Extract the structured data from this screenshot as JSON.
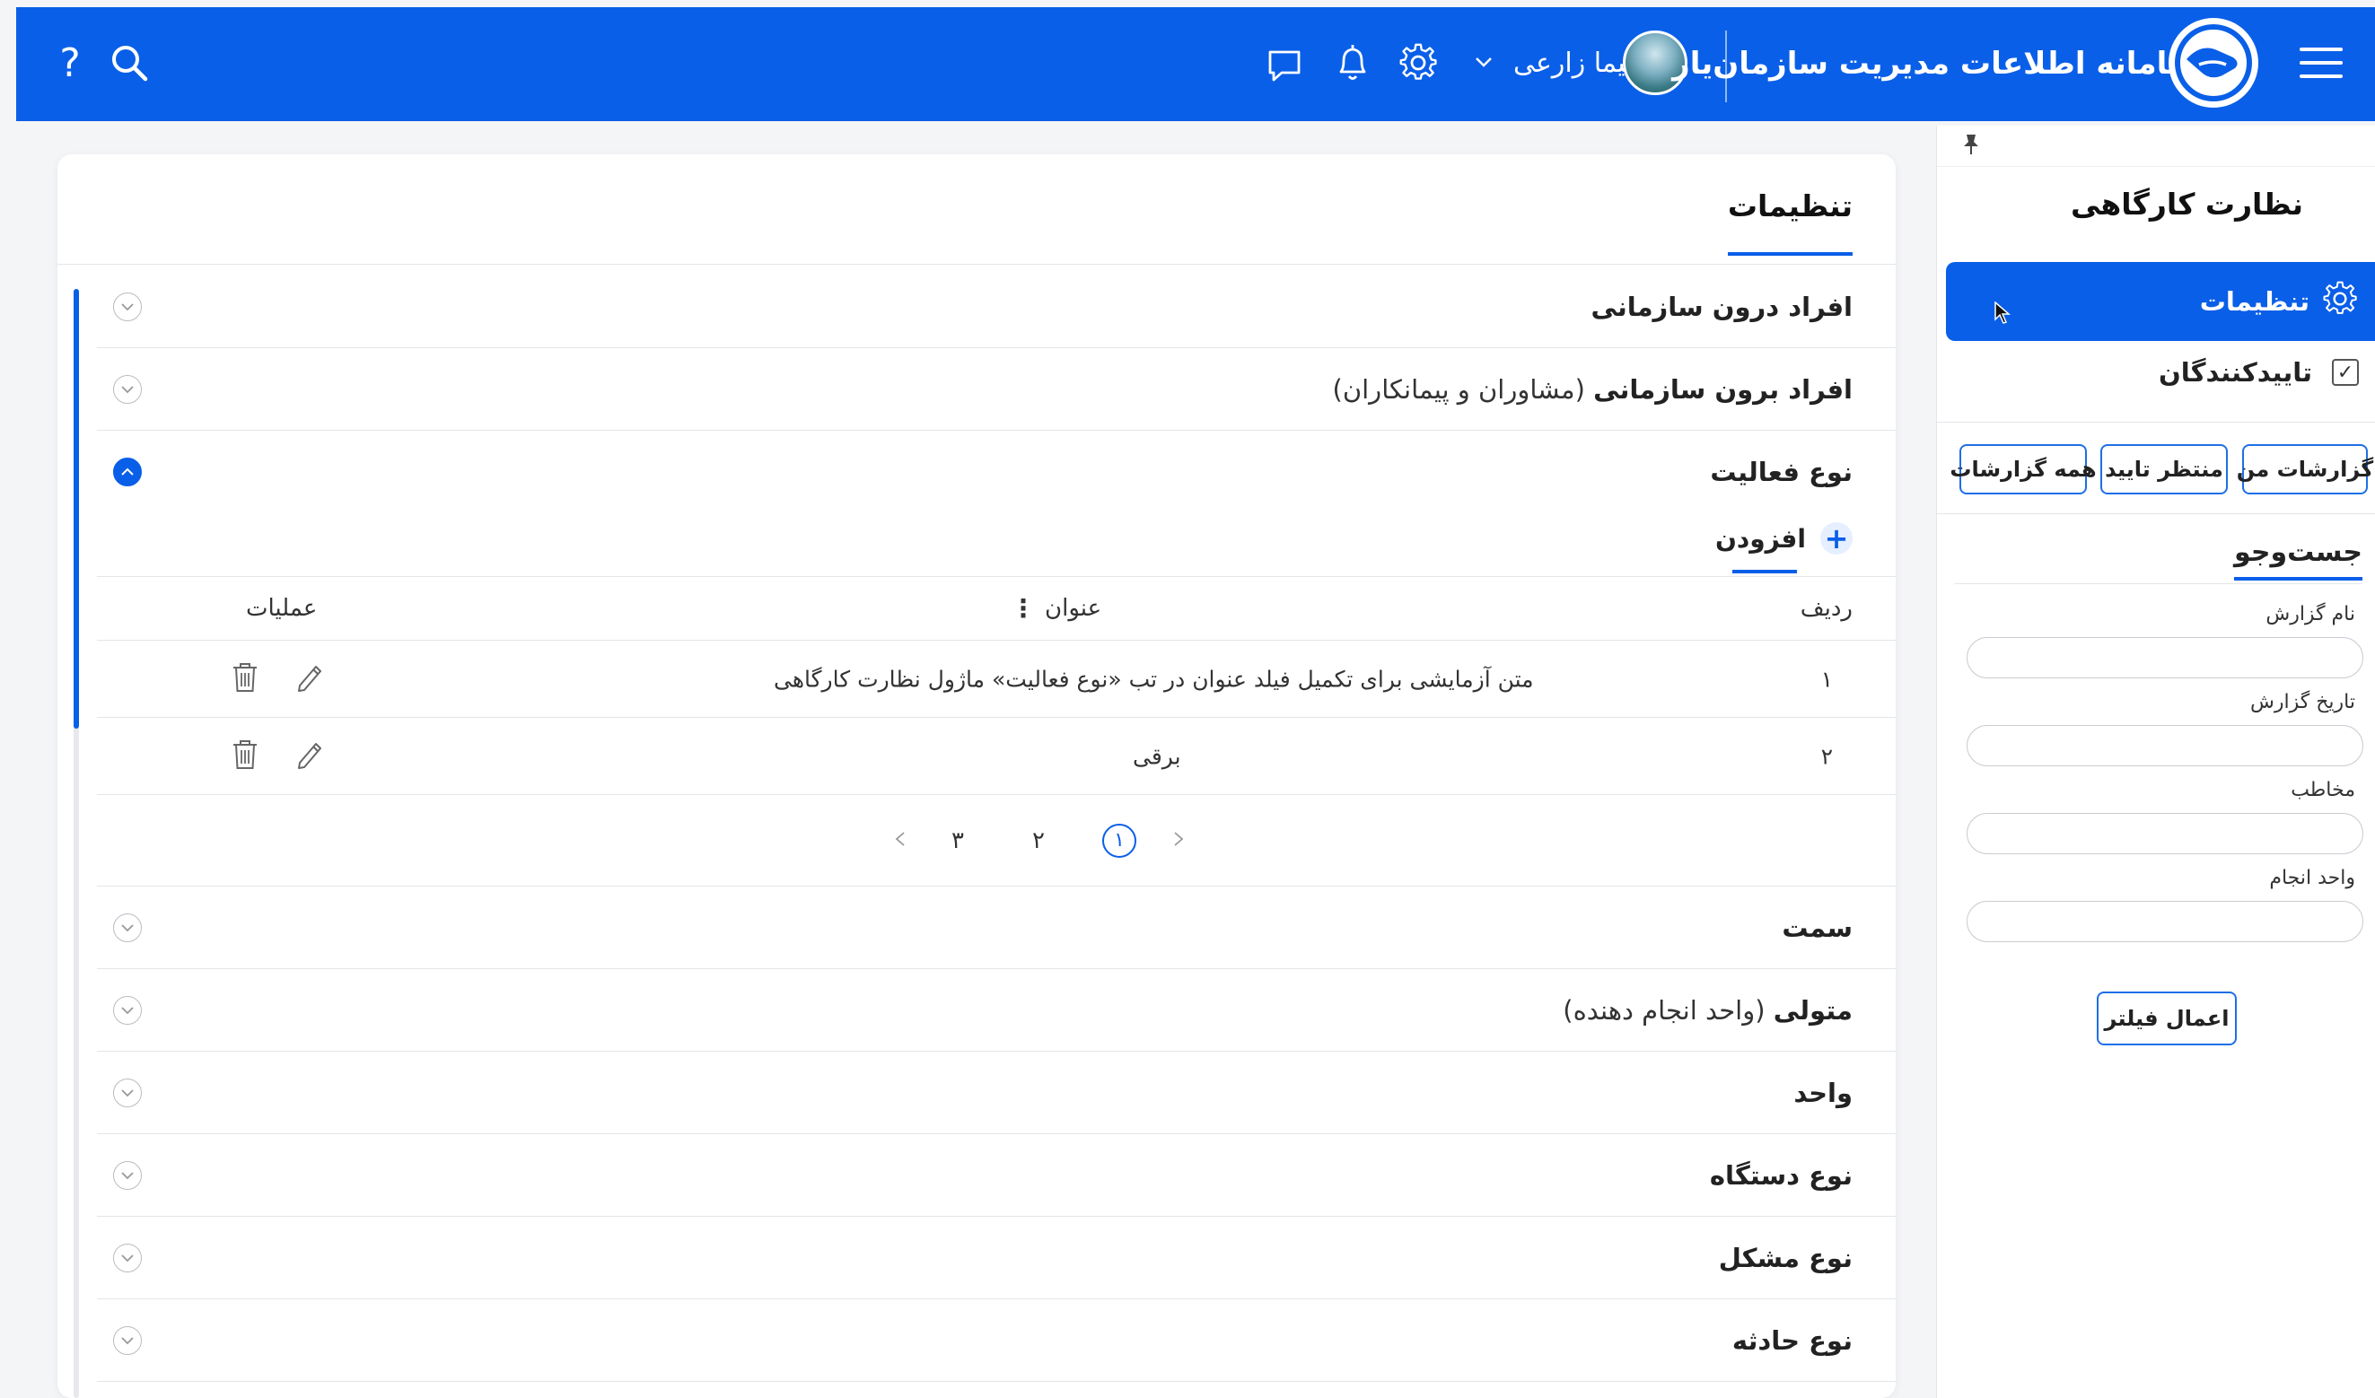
{
  "header": {
    "app_title": "سامانه اطلاعات مدیریت سازمان‌یار",
    "user_name": "نیما زارعی",
    "icons": [
      "menu-icon",
      "logo-icon",
      "chevron-down-icon",
      "gear-icon",
      "bell-icon",
      "chat-icon",
      "search-icon",
      "help-icon"
    ],
    "help_glyph": "?"
  },
  "sidebar": {
    "title": "نظارت کارگاهی",
    "active_item": "تنظیمات",
    "check_item": "تاییدکنندگان",
    "check_glyph": "✓",
    "tabs": [
      "گزارشات من",
      "منتظر تایید",
      "همه گزارشات"
    ],
    "search_tab": "جست‌وجو",
    "fields": [
      {
        "label": "نام گزارش",
        "value": ""
      },
      {
        "label": "تاریخ گزارش",
        "value": ""
      },
      {
        "label": "مخاطب",
        "value": ""
      },
      {
        "label": "واحد انجام",
        "value": ""
      }
    ],
    "apply_button": "اعمال فیلتر"
  },
  "main": {
    "title": "تنظیمات",
    "sections": [
      {
        "title": "افراد درون سازمانی",
        "sub": "",
        "open": false
      },
      {
        "title": "افراد برون سازمانی",
        "sub": "(مشاوران و پیمانکاران)",
        "open": false
      },
      {
        "title": "نوع فعالیت",
        "sub": "",
        "open": true
      },
      {
        "title": "سمت",
        "sub": "",
        "open": false
      },
      {
        "title": "متولی",
        "sub": "(واحد انجام دهنده)",
        "open": false
      },
      {
        "title": "واحد",
        "sub": "",
        "open": false
      },
      {
        "title": "نوع دستگاه",
        "sub": "",
        "open": false
      },
      {
        "title": "نوع مشکل",
        "sub": "",
        "open": false
      },
      {
        "title": "نوع حادثه",
        "sub": "",
        "open": false
      }
    ],
    "add_label": "افزودن",
    "table": {
      "columns": {
        "row": "ردیف",
        "title": "عنوان",
        "ops": "عملیات"
      },
      "rows": [
        {
          "num": "۱",
          "title": "متن آزمایشی برای تکمیل فیلد عنوان در تب «نوع فعالیت» ماژول نظارت کارگاهی"
        },
        {
          "num": "۲",
          "title": "برقی"
        }
      ]
    },
    "pagination": {
      "pages": [
        "۱",
        "۲",
        "۳"
      ],
      "current": "۱"
    }
  },
  "colors": {
    "accent": "#0a5fe8",
    "background": "#f4f5f7",
    "border": "#e3e5e9"
  }
}
